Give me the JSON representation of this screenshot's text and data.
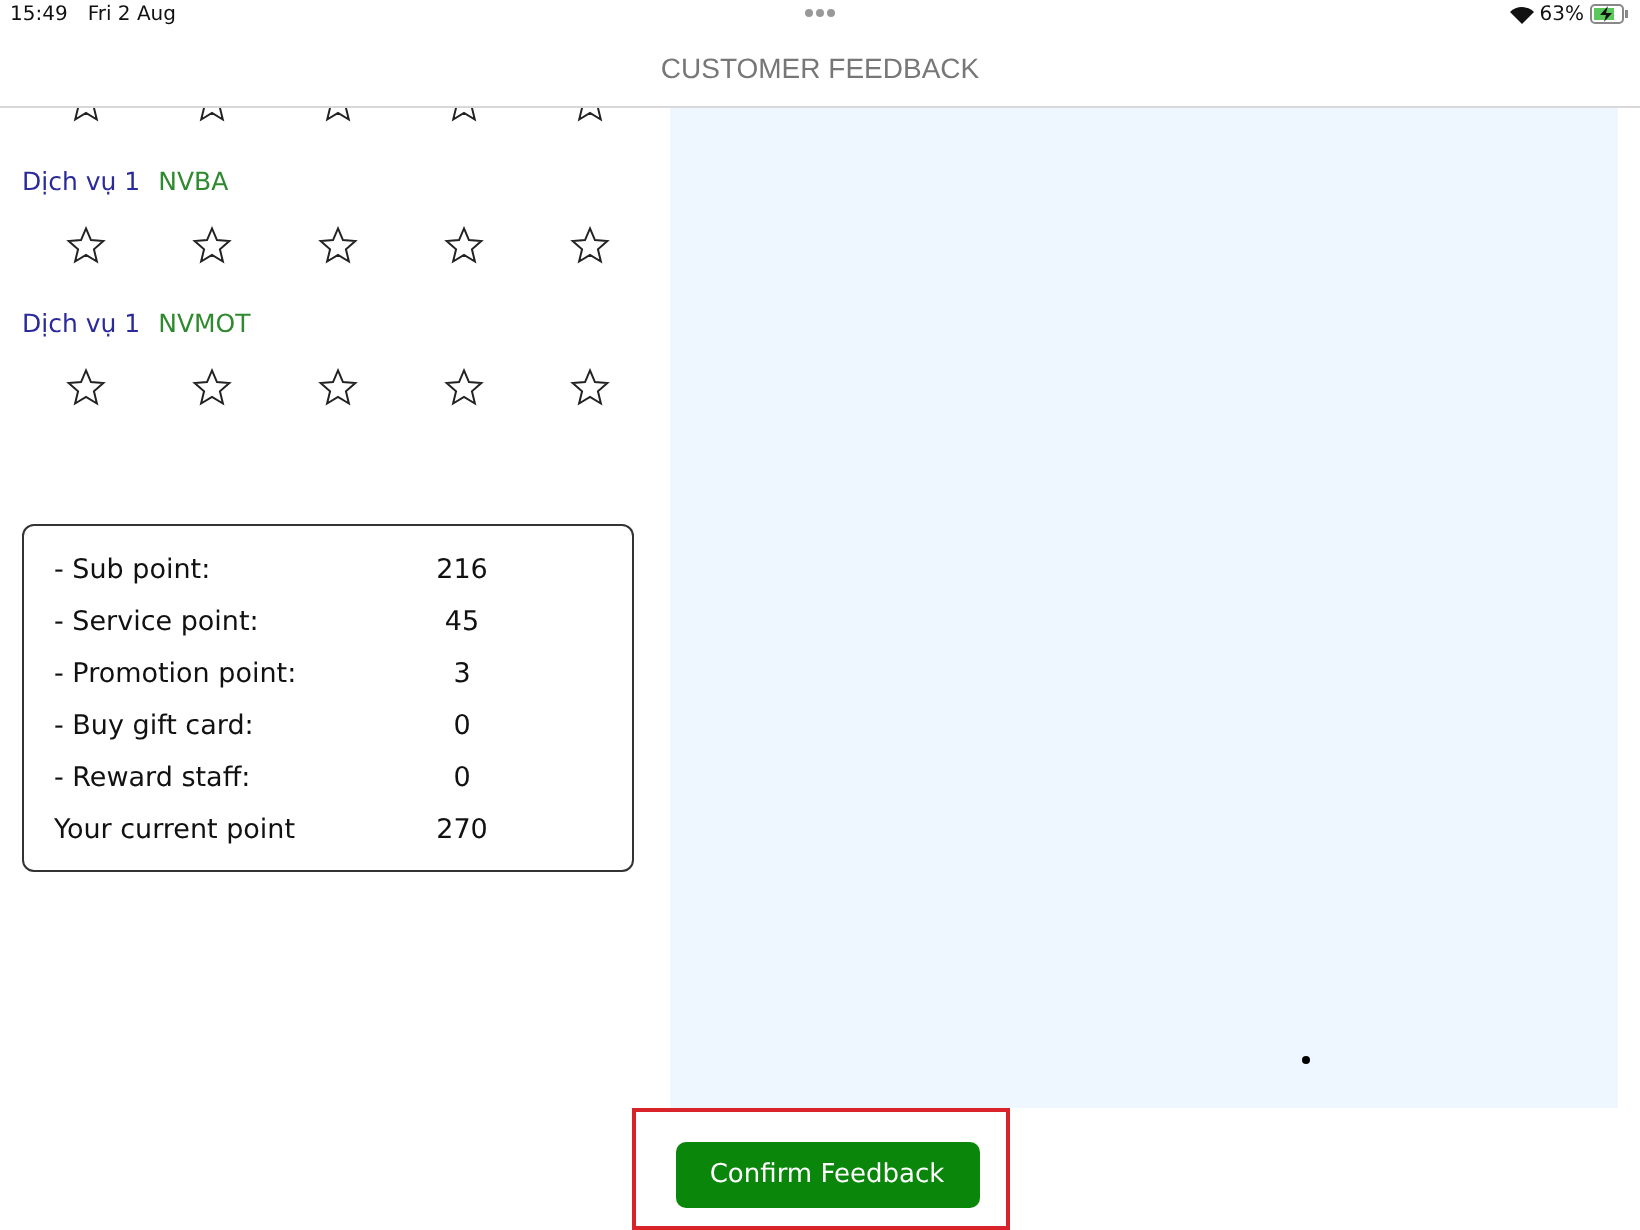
{
  "status_bar": {
    "time": "15:49",
    "date": "Fri 2 Aug",
    "battery": "63%"
  },
  "header": {
    "title": "CUSTOMER FEEDBACK"
  },
  "ratings": [
    {
      "kind": "partial"
    },
    {
      "kind": "full",
      "service": "Dịch vụ 1",
      "staff": "NVBA",
      "stars": 0
    },
    {
      "kind": "full",
      "service": "Dịch vụ 1",
      "staff": "NVMOT",
      "stars": 0
    }
  ],
  "points": [
    {
      "label": "- Sub point:",
      "value": "216"
    },
    {
      "label": "- Service point:",
      "value": "45"
    },
    {
      "label": "- Promotion point:",
      "value": "3"
    },
    {
      "label": "- Buy gift card:",
      "value": "0"
    },
    {
      "label": "- Reward staff:",
      "value": "0"
    },
    {
      "label": "Your current point",
      "value": "270"
    }
  ],
  "confirm_button": {
    "label": "Confirm Feedback",
    "highlighted": true
  }
}
